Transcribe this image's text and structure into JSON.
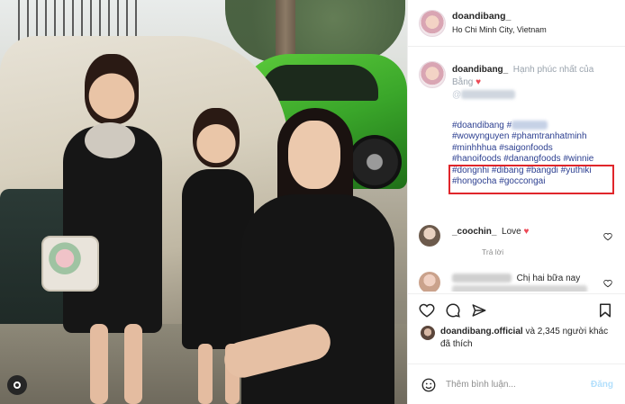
{
  "header": {
    "username": "doandibang_",
    "location": "Ho Chi Minh City, Vietnam"
  },
  "caption": {
    "username": "doandibang_",
    "text": "Hạnh phúc nhất của Bằng",
    "heart": "♥",
    "mention_prefix": "@",
    "hashtags": [
      "#doandibang #",
      "#wowynguyen #phamtranhatminh",
      "#minhhhua #saigonfoods",
      "#hanoifoods #danangfoods #winnie",
      "#dongnhi #dibang #bangdi #yuthiki",
      "#hongocha #goccongai"
    ]
  },
  "comments": [
    {
      "username": "_coochin_",
      "text": "Love",
      "heart": "♥",
      "reply_label": "Trả lời"
    },
    {
      "text": "Chị hai bữa nay"
    }
  ],
  "likes": {
    "username": "doandibang.official",
    "rest": " và 2,345 người khác",
    "line2": "đã thích"
  },
  "add_comment": {
    "placeholder": "Thêm bình luận...",
    "post_label": "Đăng"
  },
  "icons": [
    "instagram-user-icon",
    "heart-icon",
    "comment-icon",
    "share-icon",
    "bookmark-icon",
    "emoji-icon"
  ],
  "colors": {
    "hashtag": "#2c3f90",
    "highlight_box": "#e0262b",
    "heart": "#ed4956"
  }
}
